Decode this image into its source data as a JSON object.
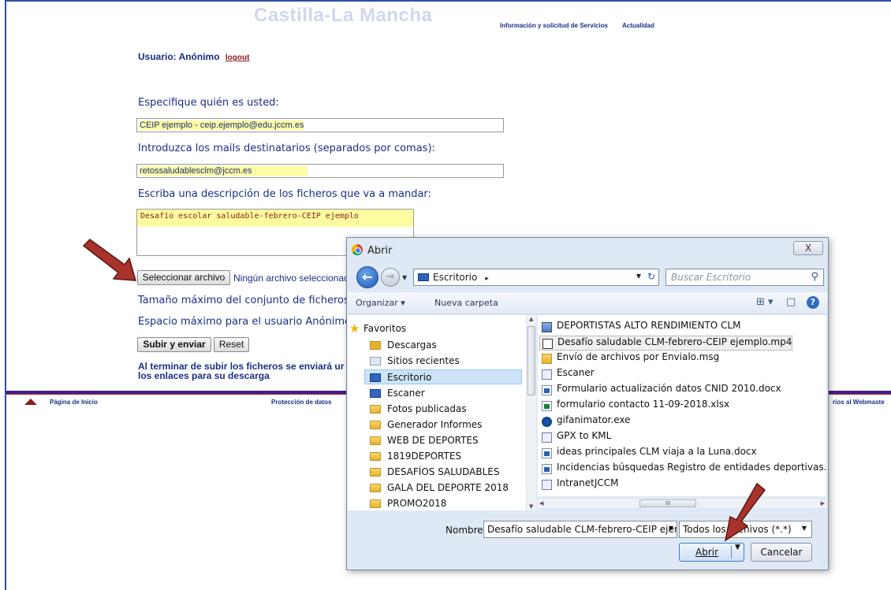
{
  "page": {
    "brand": "Castilla-La Mancha",
    "top_links": [
      "Información y solicitud de Servicios",
      "Actualidad"
    ],
    "user_label": "Usuario: Anónimo",
    "logout_label": "logout",
    "who_label": "Especifique quién es usted:",
    "who_value": "CEIP ejemplo - ceip.ejemplo@edu.jccm.es",
    "recipients_label": "Introduzca los mails destinatarios (separados por comas):",
    "recipients_value": "retossaludablesclm@jccm.es",
    "desc_label": "Escriba una descripción de los ficheros que va a mandar:",
    "desc_value": "Desafío escolar saludable-febrero-CEIP ejemplo",
    "select_file_button": "Seleccionar archivo",
    "no_file_text": "Ningún archivo seleccionad",
    "max_size_text": "Tamaño máximo del conjunto de ficheros p",
    "max_space_text": "Espacio máximo para el usuario Anónimo:",
    "submit_button": "Subir y enviar",
    "reset_button": "Reset",
    "finish_text": "Al terminar de subir los ficheros se enviará ur los enlaces para su descarga",
    "footer_links": [
      "Página de Inicio",
      "Protección de datos",
      "rios al Webmaste"
    ],
    "colors": {
      "link_blue": "#1a2f86",
      "highlight": "#fdfca0",
      "footer_bar": "#3e1f8c",
      "arrow_red": "#a8322c"
    }
  },
  "dialog": {
    "title": "Abrir",
    "close_label": "X",
    "address": "Escritorio",
    "address_chevron": "▸",
    "search_placeholder": "Buscar Escritorio",
    "toolbar": {
      "organize": "Organizar ▾",
      "new_folder": "Nueva carpeta",
      "view_icon": "⊞ ▾",
      "pane_icon": "□",
      "help": "?"
    },
    "favorites_label": "Favoritos",
    "tree": [
      "Descargas",
      "Sitios recientes",
      "Escritorio",
      "Escaner",
      "Fotos publicadas",
      "Generador Informes",
      "WEB DE DEPORTES",
      "1819DEPORTES",
      "DESAFÍOS SALUDABLES",
      "GALA DEL DEPORTE 2018",
      "PROMO2018"
    ],
    "files": [
      "DEPORTISTAS ALTO RENDIMIENTO CLM",
      "Desafío saludable CLM-febrero-CEIP ejemplo.mp4",
      "Envío de archivos por Envialo.msg",
      "Escaner",
      "Formulario actualización datos CNID 2010.docx",
      "formulario contacto 11-09-2018.xlsx",
      "gifanimator.exe",
      "GPX to KML",
      "ideas principales CLM viaja a la Luna.docx",
      "Incidencias búsquedas Registro de entidades deportivas.docx",
      "IntranetJCCM"
    ],
    "name_label": "Nombre:",
    "name_value": "Desafío saludable CLM-febrero-CEIP ejem",
    "type_value": "Todos los archivos (*.*)",
    "open_button": "Abrir",
    "cancel_button": "Cancelar"
  }
}
